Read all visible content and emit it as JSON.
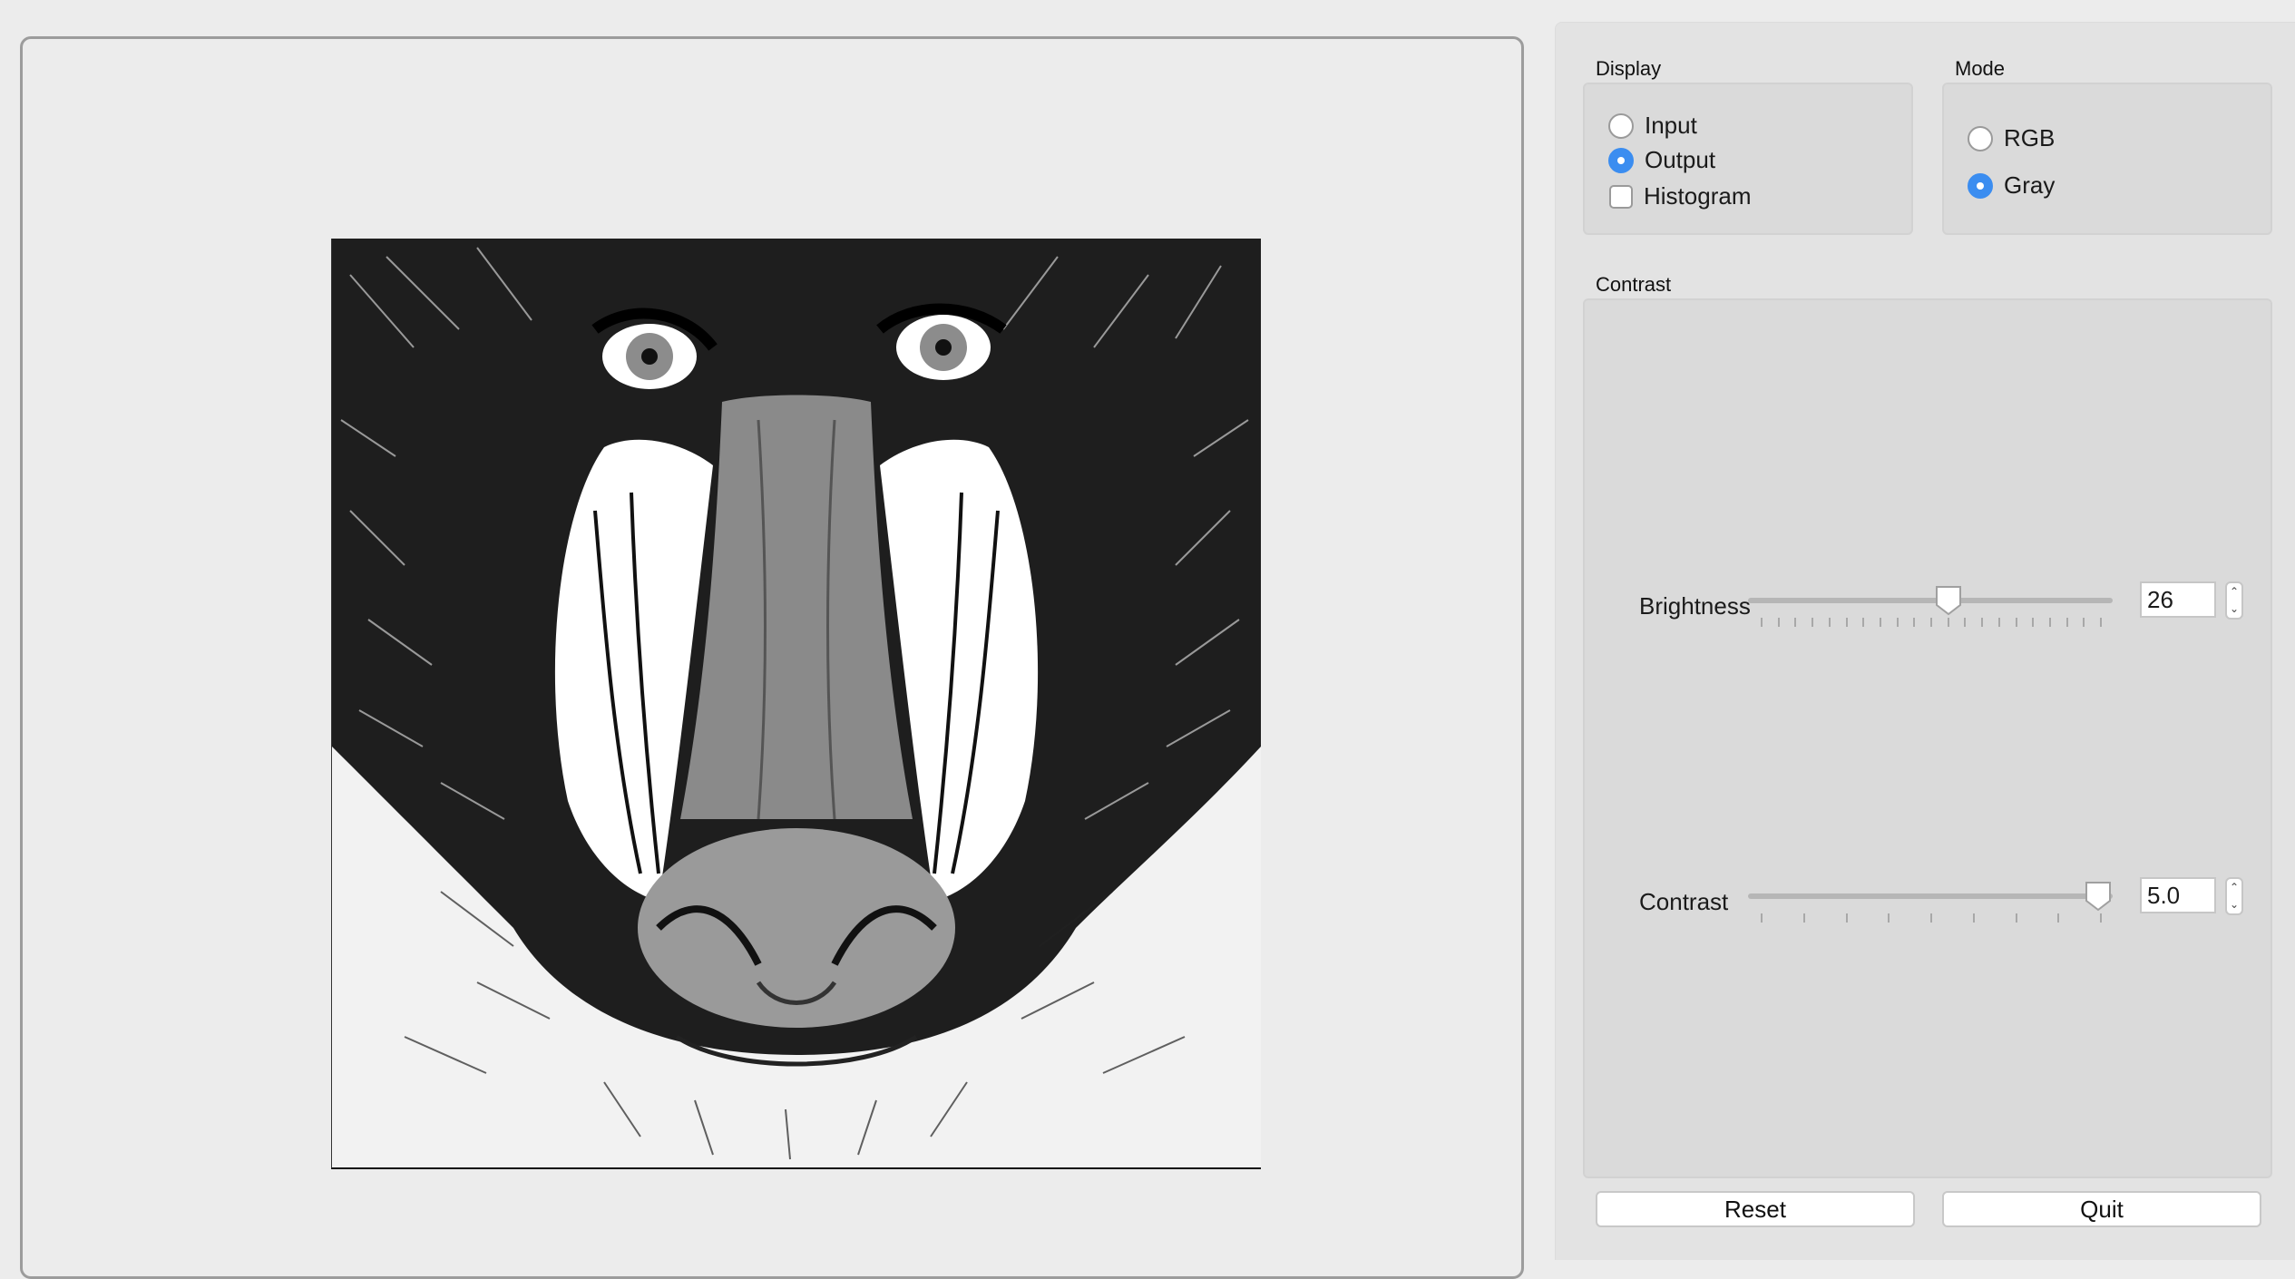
{
  "display": {
    "title": "Display",
    "options": [
      {
        "label": "Input",
        "selected": false
      },
      {
        "label": "Output",
        "selected": true
      },
      {
        "label": "Histogram",
        "checked": false
      }
    ]
  },
  "mode": {
    "title": "Mode",
    "options": [
      {
        "label": "RGB",
        "selected": false
      },
      {
        "label": "Gray",
        "selected": true
      }
    ]
  },
  "contrast_group": {
    "title": "Contrast",
    "brightness": {
      "label": "Brightness",
      "value": "26",
      "level": 0.55
    },
    "contrast": {
      "label": "Contrast",
      "value": "5.0",
      "level": 1.0
    }
  },
  "buttons": {
    "reset": "Reset",
    "quit": "Quit"
  },
  "colors": {
    "accent": "#3b8df0",
    "panel": "#e3e3e3",
    "group": "#dadada"
  },
  "image": {
    "subject": "mandrill-face-thresholded-grayscale"
  }
}
